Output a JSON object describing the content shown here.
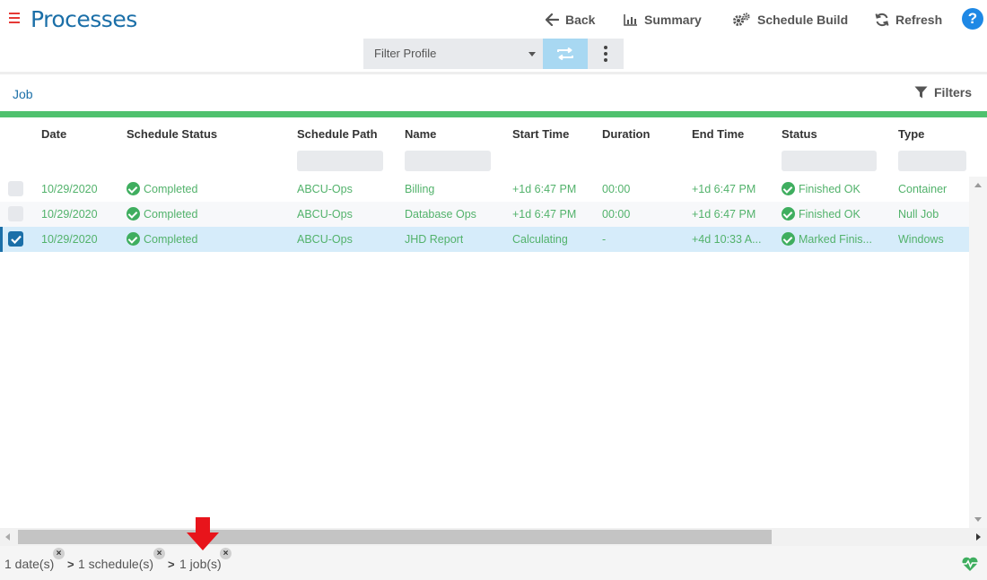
{
  "header": {
    "title": "Processes",
    "back_label": "Back",
    "summary_label": "Summary",
    "schedule_build_label": "Schedule Build",
    "refresh_label": "Refresh",
    "help_label": "?"
  },
  "filter_bar": {
    "profile_label": "Filter Profile"
  },
  "section": {
    "label": "Job",
    "filters_label": "Filters"
  },
  "table": {
    "columns": [
      "Date",
      "Schedule Status",
      "Schedule Path",
      "Name",
      "Start Time",
      "Duration",
      "End Time",
      "Status",
      "Type"
    ],
    "rows": [
      {
        "date": "10/29/2020",
        "schedule_status": "Completed",
        "schedule_path": "ABCU-Ops",
        "name": "Billing",
        "start_time": "+1d 6:47 PM",
        "duration": "00:00",
        "end_time": "+1d 6:47 PM",
        "status": "Finished OK",
        "type": "Container",
        "checked": false
      },
      {
        "date": "10/29/2020",
        "schedule_status": "Completed",
        "schedule_path": "ABCU-Ops",
        "name": "Database Ops",
        "start_time": "+1d 6:47 PM",
        "duration": "00:00",
        "end_time": "+1d 6:47 PM",
        "status": "Finished OK",
        "type": "Null Job",
        "checked": false
      },
      {
        "date": "10/29/2020",
        "schedule_status": "Completed",
        "schedule_path": "ABCU-Ops",
        "name": "JHD Report",
        "start_time": "Calculating",
        "duration": "-",
        "end_time": "+4d 10:33 A...",
        "status": "Marked Finis...",
        "type": "Windows",
        "checked": true
      }
    ]
  },
  "footer": {
    "crumbs": [
      "1 date(s)",
      "1 schedule(s)",
      "1 job(s)"
    ],
    "crumb_close": "×",
    "separator": ">"
  },
  "colors": {
    "accent": "#1b6fa8",
    "success": "#4fc16e",
    "row_text": "#52b26b",
    "selected_row": "#d6ecfa",
    "hamburger": "#e53935",
    "help": "#1e88e5",
    "arrow": "#e8141b"
  },
  "icons": {
    "menu": "hamburger-icon",
    "back": "arrow-left-icon",
    "summary": "bar-chart-icon",
    "schedule_build": "gears-icon",
    "refresh": "refresh-icon",
    "help": "question-circle-icon",
    "sync": "swap-icon",
    "more": "vertical-dots-icon",
    "filters": "funnel-icon",
    "status_ok": "check-circle-icon",
    "health": "heartbeat-icon",
    "annotation": "red-down-arrow-icon"
  }
}
